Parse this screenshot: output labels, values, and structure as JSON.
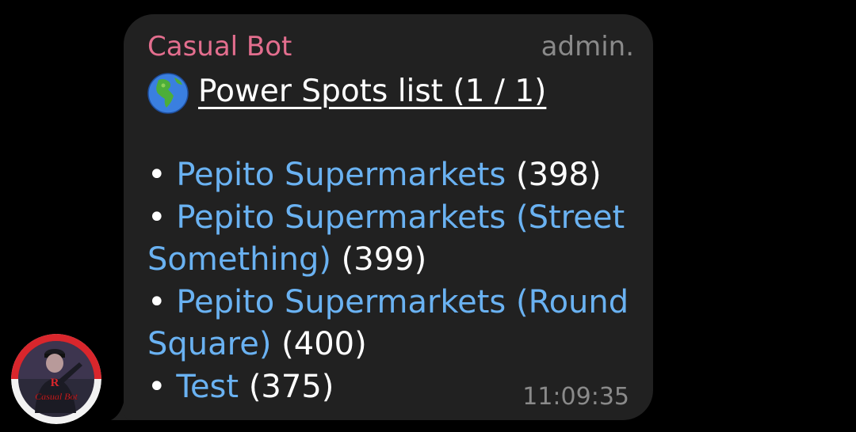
{
  "message": {
    "sender_name": "Casual Bot",
    "sender_role": "admin.",
    "title_icon": "globe-americas-icon",
    "title": "Power Spots list (1 / 1)",
    "bullet": "•",
    "items": [
      {
        "name": "Pepito Supermarkets",
        "count": "(398)"
      },
      {
        "name": "Pepito Supermarkets (Street Something)",
        "count": "(399)"
      },
      {
        "name": "Pepito Supermarkets (Round Square)",
        "count": "(400)"
      },
      {
        "name": "Test",
        "count": "(375)"
      }
    ],
    "timestamp": "11:09:35"
  },
  "avatar": {
    "label": "Casual Bot",
    "emblem": "R"
  },
  "colors": {
    "background": "#000000",
    "bubble": "#212121",
    "sender": "#e36e8e",
    "link": "#6ab2f2",
    "muted": "#8a8a8a"
  }
}
